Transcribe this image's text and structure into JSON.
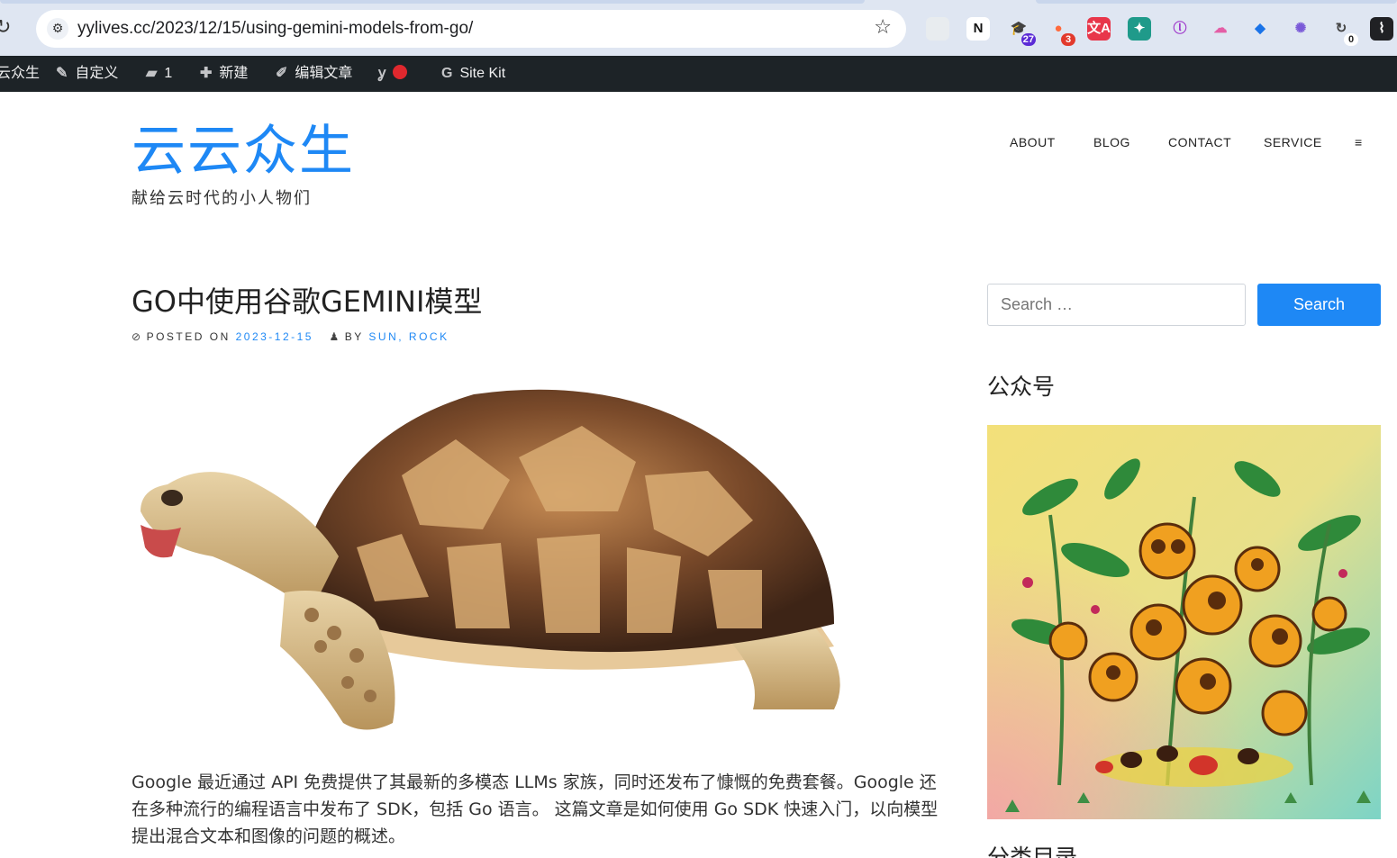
{
  "browser": {
    "url": "yylives.cc/2023/12/15/using-gemini-models-from-go/",
    "extensions": [
      {
        "icon": "circle-extension-icon",
        "label": "",
        "bg": "#e8ecef",
        "color": "#6cb56c",
        "badge": ""
      },
      {
        "icon": "notion-icon",
        "label": "N",
        "bg": "#ffffff",
        "color": "#111111",
        "badge": ""
      },
      {
        "icon": "graduation-cap-icon",
        "label": "🎓",
        "bg": "transparent",
        "color": "#5b2bd6",
        "badge": "27",
        "badge_bg": "#5b2bd6"
      },
      {
        "icon": "chat-bubbles-icon",
        "label": "●",
        "bg": "transparent",
        "color": "#ff6a3d",
        "badge": "3",
        "badge_bg": "#e23a2d"
      },
      {
        "icon": "translate-icon",
        "label": "文A",
        "bg": "#e8364a",
        "color": "#ffffff",
        "badge": ""
      },
      {
        "icon": "bug-icon",
        "label": "✦",
        "bg": "#1f9a8a",
        "color": "#ffffff",
        "badge": ""
      },
      {
        "icon": "purple-logo-icon",
        "label": "ⓛ",
        "bg": "transparent",
        "color": "#9b2fc9",
        "badge": ""
      },
      {
        "icon": "cloud-icon",
        "label": "☁",
        "bg": "transparent",
        "color": "#e45ea6",
        "badge": ""
      },
      {
        "icon": "bookmark-icon",
        "label": "◆",
        "bg": "transparent",
        "color": "#1a73e8",
        "badge": ""
      },
      {
        "icon": "openai-icon",
        "label": "✺",
        "bg": "transparent",
        "color": "#7a5ad8",
        "badge": ""
      },
      {
        "icon": "sync-icon",
        "label": "↻",
        "bg": "transparent",
        "color": "#444444",
        "badge": "0",
        "badge_bg": "#ffffff"
      },
      {
        "icon": "app-icon",
        "label": "⌇",
        "bg": "#202124",
        "color": "#ffffff",
        "badge": ""
      }
    ]
  },
  "adminbar": {
    "site": "云众生",
    "customize": "自定义",
    "comments": "1",
    "new": "新建",
    "edit": "编辑文章",
    "sitekit": "Site Kit"
  },
  "site": {
    "title": "云云众生",
    "tagline": "献给云时代的小人物们"
  },
  "nav": {
    "items": [
      "ABOUT",
      "BLOG",
      "CONTACT",
      "SERVICE",
      "≡"
    ]
  },
  "post": {
    "title": "GO中使用谷歌GEMINI模型",
    "posted_on_label": "POSTED ON",
    "date": "2023-12-15",
    "by_label": "BY",
    "author": "SUN, ROCK",
    "body": "Google 最近通过 API 免费提供了其最新的多模态 LLMs 家族，同时还发布了慷慨的免费套餐。Google 还在多种流行的编程语言中发布了 SDK，包括 Go 语言。 这篇文章是如何使用 Go SDK 快速入门，以向模型提出混合文本和图像的问题的概述。"
  },
  "sidebar": {
    "search_placeholder": "Search …",
    "search_button": "Search",
    "widget1_title": "公众号",
    "widget2_title": "分类目录"
  },
  "colors": {
    "accent": "#1e88f5",
    "adminbar": "#1d2327"
  }
}
